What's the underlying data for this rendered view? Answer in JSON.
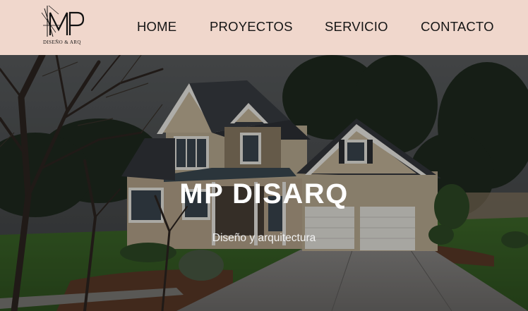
{
  "brand": {
    "monogram": "MP",
    "tagline": "DISEÑO & ARQ"
  },
  "nav": {
    "items": [
      {
        "label": "HOME"
      },
      {
        "label": "PROYECTOS"
      },
      {
        "label": "SERVICIO"
      },
      {
        "label": "CONTACTO"
      }
    ]
  },
  "hero": {
    "title": "MP DISARQ",
    "subtitle": "Diseño y arquitectura",
    "image_description_icon": "house-photo"
  },
  "colors": {
    "navbar_bg": "#f0d7cc",
    "nav_text": "#151515",
    "hero_text": "#ffffff"
  }
}
